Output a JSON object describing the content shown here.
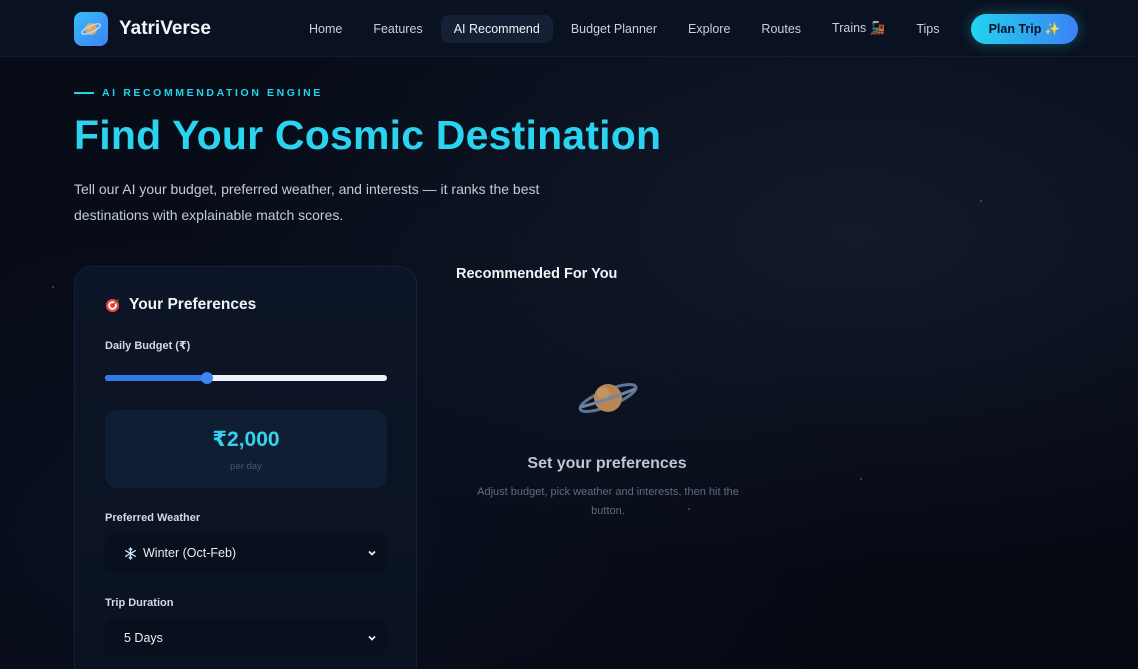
{
  "brand": {
    "name": "YatriVerse",
    "icon": "planet-icon"
  },
  "nav": {
    "links": [
      {
        "label": "Home",
        "active": false
      },
      {
        "label": "Features",
        "active": false
      },
      {
        "label": "AI Recommend",
        "active": true
      },
      {
        "label": "Budget Planner",
        "active": false
      },
      {
        "label": "Explore",
        "active": false
      },
      {
        "label": "Routes",
        "active": false
      },
      {
        "label": "Trains 🚂",
        "active": false
      },
      {
        "label": "Tips",
        "active": false
      }
    ],
    "cta_label": "Plan Trip ✨"
  },
  "hero": {
    "eyebrow": "AI RECOMMENDATION ENGINE",
    "title": "Find Your Cosmic Destination",
    "subtitle": "Tell our AI your budget, preferred weather, and interests — it ranks the best destinations with explainable match scores."
  },
  "preferences": {
    "title": "Your Preferences",
    "title_icon": "target-icon",
    "budget_label": "Daily Budget (₹)",
    "budget_slider_fraction": 0.36,
    "budget_value": "₹2,000",
    "budget_unit": "per day",
    "weather_label": "Preferred Weather",
    "weather_icon": "snowflake-icon",
    "weather_value": "Winter (Oct-Feb)",
    "duration_label": "Trip Duration",
    "duration_value": "5 Days"
  },
  "results": {
    "title": "Recommended For You",
    "empty_icon": "planet-icon",
    "empty_title": "Set your preferences",
    "empty_subtitle": "Adjust budget, pick weather and interests, then hit the button."
  },
  "colors": {
    "accent": "#22d3ee",
    "accent_blue": "#3b82f6",
    "background": "#060a14",
    "card": "#0c1527"
  }
}
